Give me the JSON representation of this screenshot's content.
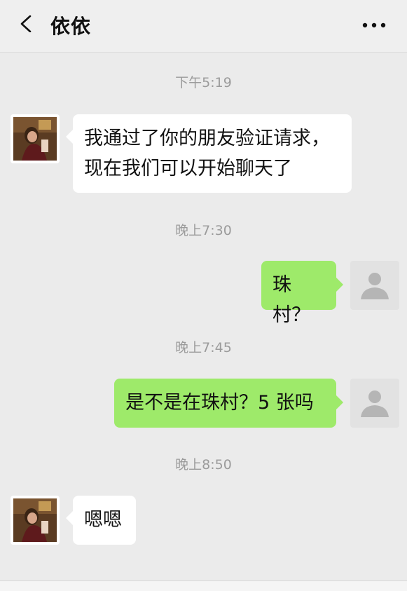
{
  "header": {
    "title": "依依"
  },
  "messages": [
    {
      "time": "下午5:19",
      "from": "contact",
      "lines": [
        "我通过了你的朋友验证请求，",
        "现在我们可以开始聊天了"
      ]
    },
    {
      "time": "晚上7:30",
      "from": "me",
      "lines": [
        "珠村？"
      ]
    },
    {
      "time": "晚上7:45",
      "from": "me",
      "lines": [
        "是不是在珠村？5 张吗"
      ]
    },
    {
      "time": "晚上8:50",
      "from": "contact",
      "lines": [
        "嗯嗯"
      ]
    }
  ],
  "colors": {
    "background": "#ebebeb",
    "bubble_me": "#9eea6a",
    "bubble_contact": "#ffffff",
    "timestamp": "#9b9b9b"
  },
  "icons": {
    "back": "chevron-left-icon",
    "more": "more-dots-icon",
    "default_avatar": "user-silhouette-icon"
  }
}
